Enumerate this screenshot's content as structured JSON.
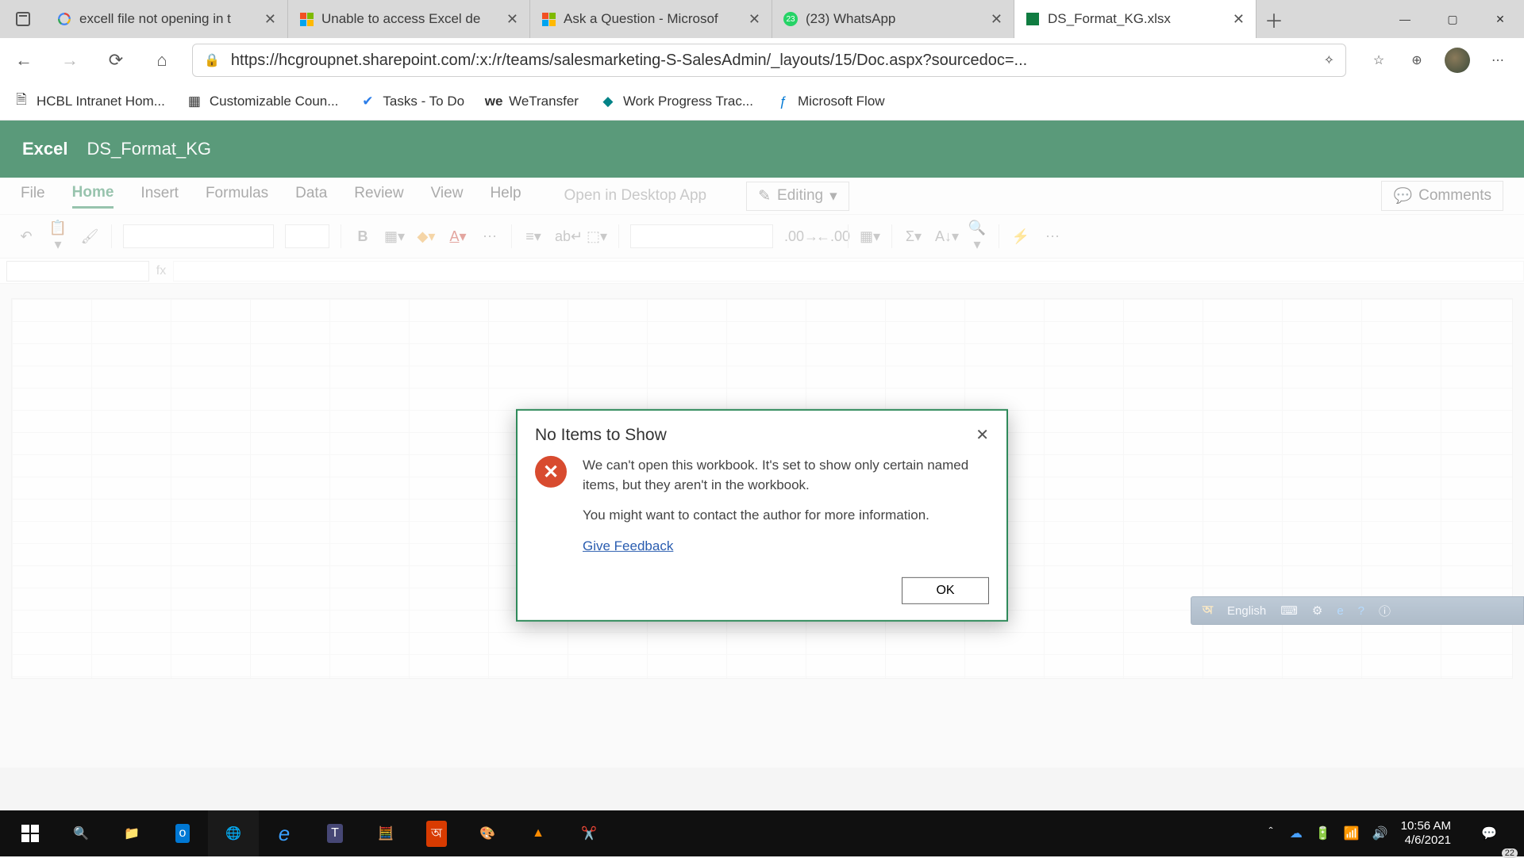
{
  "browser": {
    "tabs": [
      {
        "title": "excell file not opening in t",
        "favicon": "google"
      },
      {
        "title": "Unable to access Excel de",
        "favicon": "microsoft"
      },
      {
        "title": "Ask a Question - Microsof",
        "favicon": "microsoft"
      },
      {
        "title": "(23) WhatsApp",
        "favicon": "whatsapp",
        "badge": "23"
      },
      {
        "title": "DS_Format_KG.xlsx",
        "favicon": "excel",
        "active": true
      }
    ],
    "url": "https://hcgroupnet.sharepoint.com/:x:/r/teams/salesmarketing-S-SalesAdmin/_layouts/15/Doc.aspx?sourcedoc=...",
    "bookmarks": [
      "HCBL Intranet Hom...",
      "Customizable Coun...",
      "Tasks - To Do",
      "WeTransfer",
      "Work Progress Trac...",
      "Microsoft Flow"
    ]
  },
  "excel": {
    "app": "Excel",
    "doc": "DS_Format_KG",
    "tabs": [
      "File",
      "Home",
      "Insert",
      "Formulas",
      "Data",
      "Review",
      "View",
      "Help"
    ],
    "active_tab": "Home",
    "open_desktop": "Open in Desktop App",
    "editing": "Editing",
    "comments": "Comments"
  },
  "dialog": {
    "title": "No Items to Show",
    "line1": "We can't open this workbook. It's set to show only certain named items, but they aren't in the workbook.",
    "line2": "You might want to contact the author for more information.",
    "link": "Give Feedback",
    "ok": "OK"
  },
  "ime": {
    "lang": "English"
  },
  "system": {
    "time": "10:56 AM",
    "date": "4/6/2021",
    "notif_badge": "22"
  }
}
